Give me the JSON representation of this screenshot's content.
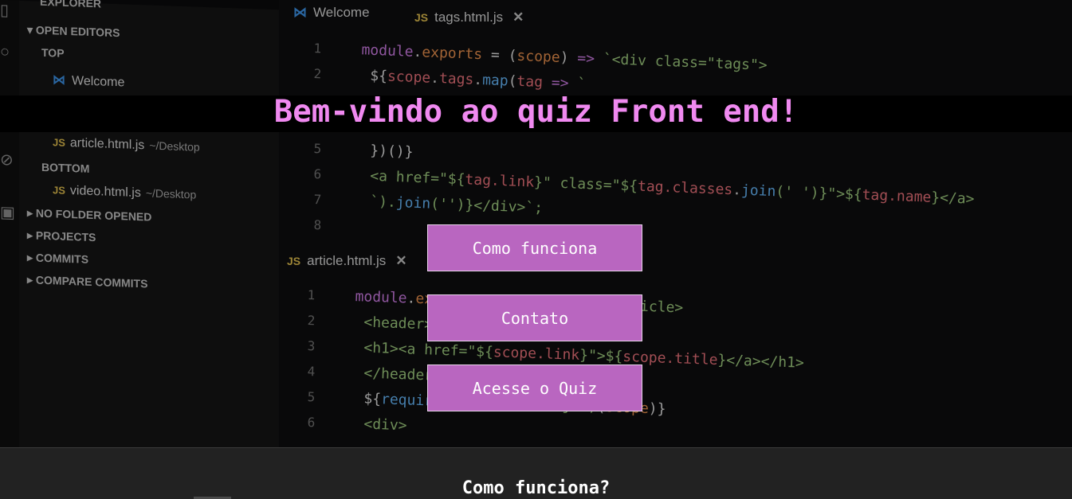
{
  "hero": {
    "title": "Bem-vindo ao quiz Front end!",
    "buttons": {
      "how_it_works": "Como funciona",
      "contact": "Contato",
      "quiz": "Acesse o Quiz"
    }
  },
  "section": {
    "heading": "Como funciona?"
  },
  "background": {
    "sidebar": {
      "explorer": "EXPLORER",
      "open_editors": "OPEN EDITORS",
      "top": "TOP",
      "welcome": "Welcome",
      "article_file": "article.html.js",
      "article_path": "~/Desktop",
      "bottom": "BOTTOM",
      "video_file": "video.html.js",
      "video_path": "~/Desktop",
      "no_folder": "NO FOLDER OPENED",
      "projects": "PROJECTS",
      "commits": "COMMITS",
      "compare_commits": "COMPARE COMMITS"
    },
    "tabs": {
      "welcome": "Welcome",
      "tags": "tags.html.js",
      "article": "article.html.js"
    }
  },
  "colors": {
    "accent_title": "#f089f0",
    "button_bg": "#b966c0",
    "section_bg": "#222222"
  }
}
